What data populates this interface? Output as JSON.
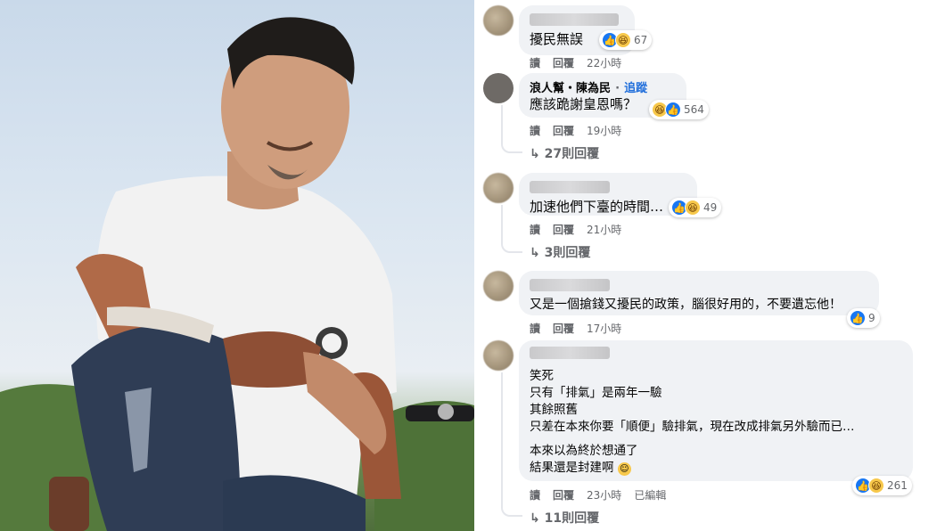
{
  "comments": [
    {
      "text": "擾民無誤",
      "reaction_count": "67",
      "reply": "回覆",
      "read": "讀",
      "time": "22小時",
      "reply_count": ""
    },
    {
      "name": "浪人幫・陳為民",
      "follow": "追蹤",
      "text": "應該跪謝皇恩嗎？",
      "reaction_count": "564",
      "read": "讀",
      "reply": "回覆",
      "time": "19小時",
      "reply_count": "27則回覆"
    },
    {
      "text": "加速他們下臺的時間…",
      "reaction_count": "49",
      "read": "讀",
      "reply": "回覆",
      "time": "21小時",
      "reply_count": "3則回覆"
    },
    {
      "text": "又是一個搶錢又擾民的政策，腦很好用的，不要遺忘他！",
      "reaction_count": "9",
      "read": "讀",
      "reply": "回覆",
      "time": "17小時"
    },
    {
      "lines": [
        "笑死",
        "只有「排氣」是兩年一驗",
        "其餘照舊",
        "只差在本來你要「順便」驗排氣，現在改成排氣另外驗而已…",
        "本來以為終於想通了",
        "結果還是封建啊"
      ],
      "reaction_count": "261",
      "read": "讀",
      "reply": "回覆",
      "time": "23小時",
      "edited": "已編輯",
      "reply_count": "11則回覆"
    }
  ],
  "icons": {
    "like": "like-icon",
    "haha": "haha-icon",
    "reply_arrow": "reply-arrow-icon",
    "smile": "smile-emoji-icon"
  },
  "colors": {
    "like": "#1877f2",
    "haha": "#f7c84b",
    "bubble": "#f0f2f5",
    "follow": "#216fdb"
  }
}
